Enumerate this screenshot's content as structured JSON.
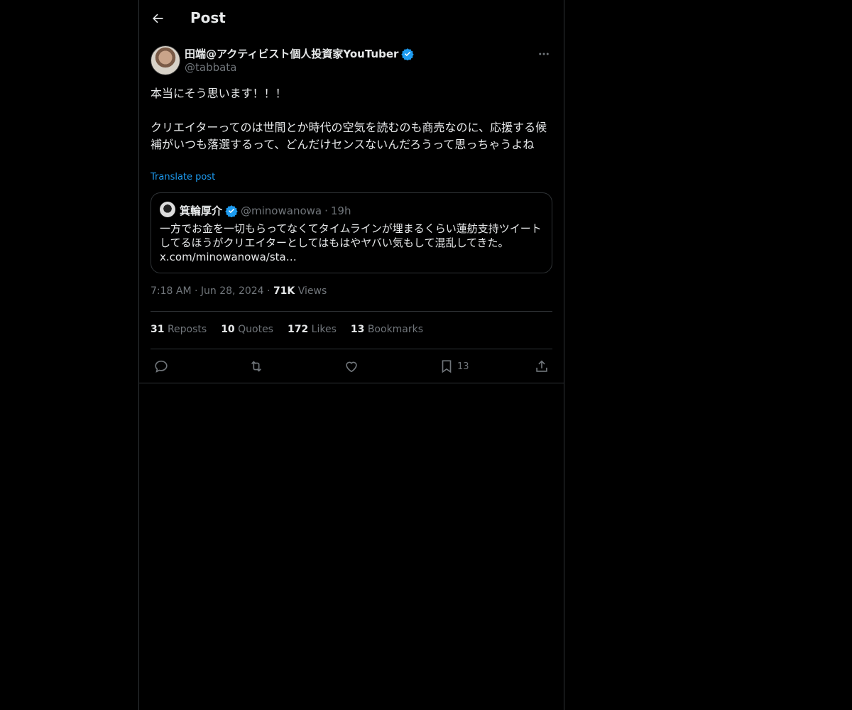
{
  "header": {
    "title": "Post",
    "back_icon": "arrow-left-icon"
  },
  "post": {
    "author_name": "田端@アクティビスト個人投資家YouTuber",
    "author_handle": "@tabbata",
    "text": "本当にそう思います！！！\n\nクリエイターってのは世間とか時代の空気を読むのも商売なのに、応援する候補がいつも落選するって、どんだけセンスないんだろうって思っちゃうよね",
    "translate_label": "Translate post"
  },
  "quote": {
    "name": "箕輪厚介",
    "handle": "@minowanowa",
    "separator": "·",
    "age": "19h",
    "text": "一方でお金を一切もらってなくてタイムラインが埋まるくらい蓮舫支持ツイートしてるほうがクリエイターとしてはもはやヤバい気もして混乱してきた。",
    "link": "x.com/minowanowa/sta…"
  },
  "meta": {
    "time": "7:18 AM",
    "dot1": "·",
    "date": "Jun 28, 2024",
    "dot2": "·",
    "views_count": "71K",
    "views_label": "Views"
  },
  "stats": [
    {
      "count": "31",
      "label": "Reposts"
    },
    {
      "count": "10",
      "label": "Quotes"
    },
    {
      "count": "172",
      "label": "Likes"
    },
    {
      "count": "13",
      "label": "Bookmarks"
    }
  ],
  "actions": {
    "reply_icon": "reply-icon",
    "repost_icon": "repost-icon",
    "like_icon": "heart-icon",
    "bookmark_icon": "bookmark-icon",
    "bookmark_count": "13",
    "share_icon": "share-icon"
  },
  "colors": {
    "background": "#000000",
    "text": "#e7e9ea",
    "muted": "#71767b",
    "accent": "#1d9bf0",
    "border": "#2f3336"
  }
}
